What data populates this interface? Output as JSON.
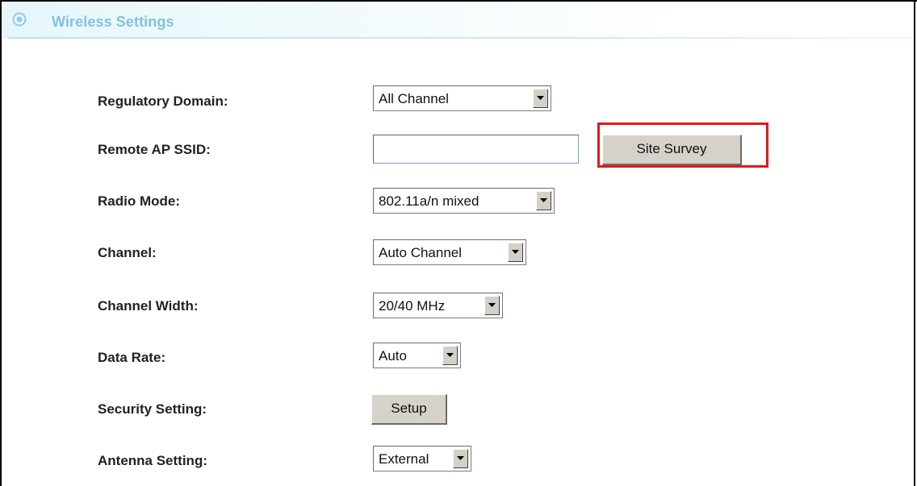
{
  "header": {
    "title": "Wireless Settings",
    "icon": "target-circle-icon",
    "accent_color": "#7fc4dc"
  },
  "form": {
    "regulatory_domain": {
      "label": "Regulatory Domain:",
      "value": "All Channel"
    },
    "remote_ap_ssid": {
      "label": "Remote AP SSID:",
      "value": "",
      "button_label": "Site Survey"
    },
    "radio_mode": {
      "label": "Radio Mode:",
      "value": "802.11a/n mixed"
    },
    "channel": {
      "label": "Channel:",
      "value": "Auto Channel"
    },
    "channel_width": {
      "label": "Channel Width:",
      "value": "20/40 MHz"
    },
    "data_rate": {
      "label": "Data Rate:",
      "value": "Auto"
    },
    "security_setting": {
      "label": "Security Setting:",
      "button_label": "Setup"
    },
    "antenna_setting": {
      "label": "Antenna Setting:",
      "value": "External"
    }
  },
  "annotation": {
    "highlight_color": "#e11919"
  }
}
